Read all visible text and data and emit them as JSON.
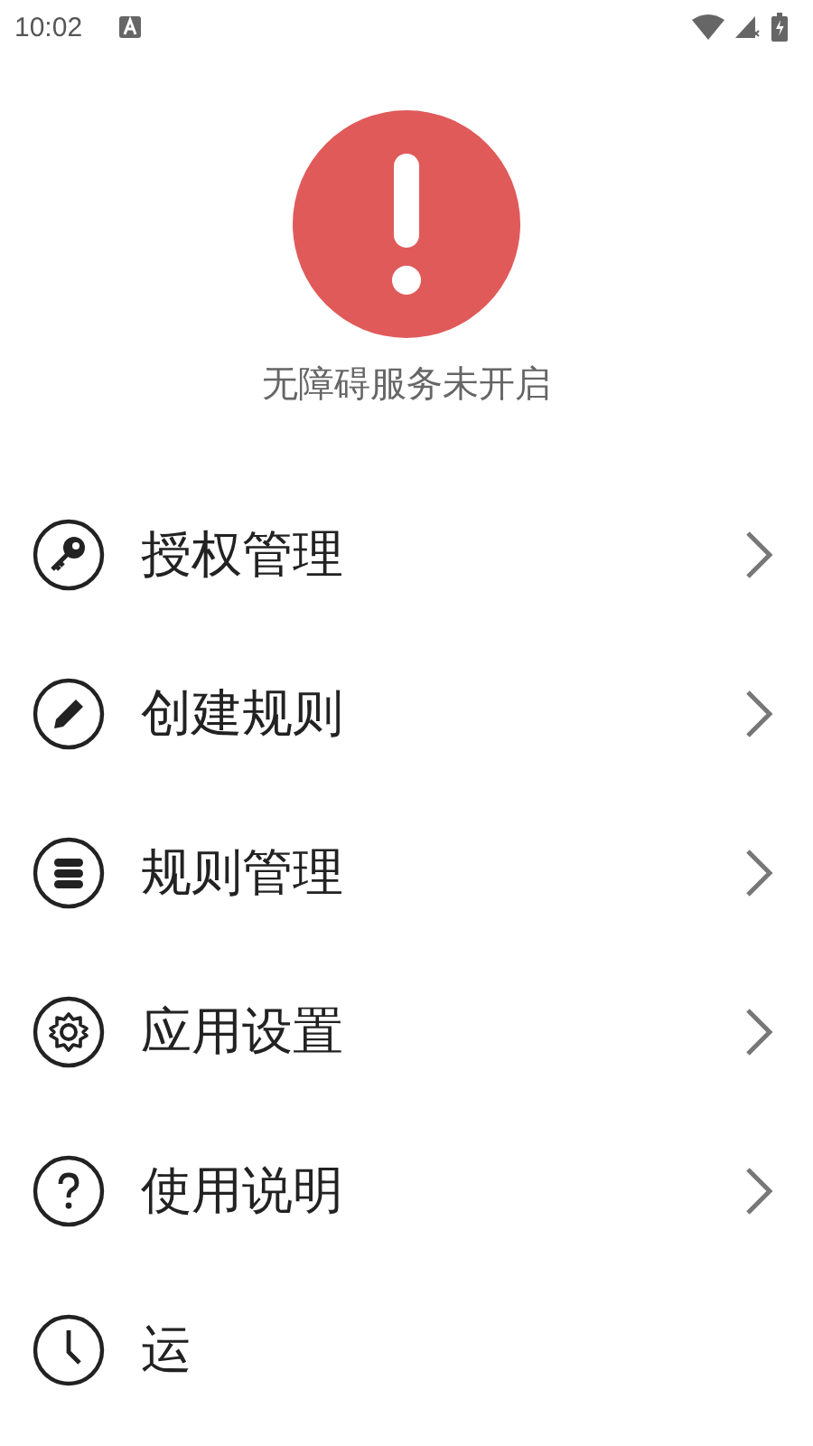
{
  "status_bar": {
    "time": "10:02"
  },
  "status": {
    "message": "无障碍服务未开启"
  },
  "menu": [
    {
      "label": "授权管理",
      "chevron": true
    },
    {
      "label": "创建规则",
      "chevron": true
    },
    {
      "label": "规则管理",
      "chevron": true
    },
    {
      "label": "应用设置",
      "chevron": true
    },
    {
      "label": "使用说明",
      "chevron": true
    },
    {
      "label": "运",
      "chevron": false
    }
  ]
}
